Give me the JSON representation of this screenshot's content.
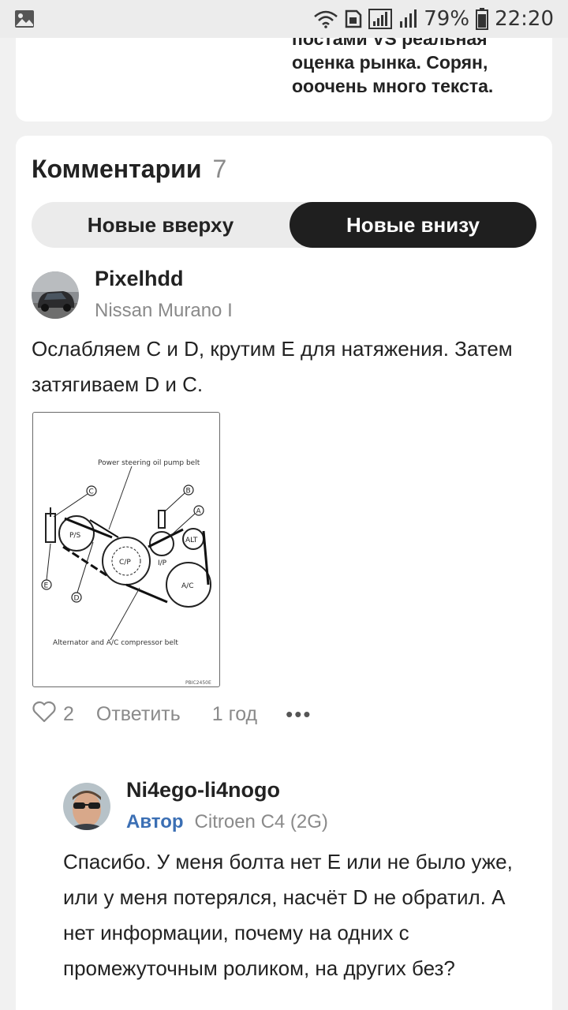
{
  "status_bar": {
    "battery": "79%",
    "time": "22:20"
  },
  "prev_post": {
    "text_line1": "постами VS реальная",
    "text_line2": "оценка рынка. Сорян,",
    "text_line3": "ооочень много текста."
  },
  "comments": {
    "title": "Комментарии",
    "count": "7",
    "sort": {
      "newest_top": "Новые вверху",
      "newest_bottom": "Новые внизу",
      "selected": "newest_bottom"
    },
    "items": [
      {
        "author": "Pixelhdd",
        "car": "Nissan Murano I",
        "text": "Ослабляем C и D, крутим E для натяжения. Затем затягиваем D и C.",
        "diagram": {
          "top_caption": "Power steering oil pump belt",
          "bottom_caption": "Alternator and A/C compressor belt",
          "code": "PBIC2450E",
          "labels": [
            "A",
            "B",
            "C",
            "D",
            "E"
          ],
          "pulleys": [
            "P/S",
            "C/P",
            "I/P",
            "ALT",
            "A/C"
          ]
        },
        "likes": "2",
        "reply_label": "Ответить",
        "time": "1 год",
        "more": "•••"
      },
      {
        "author": "Ni4ego-li4nogo",
        "badge": "Автор",
        "car": "Citroen C4 (2G)",
        "text": "Спасибо. У меня болта нет E или не было уже, или у меня потерялся, насчёт D не обратил. А нет информации, почему на одних с промежуточным роликом, на других без?"
      }
    ]
  }
}
